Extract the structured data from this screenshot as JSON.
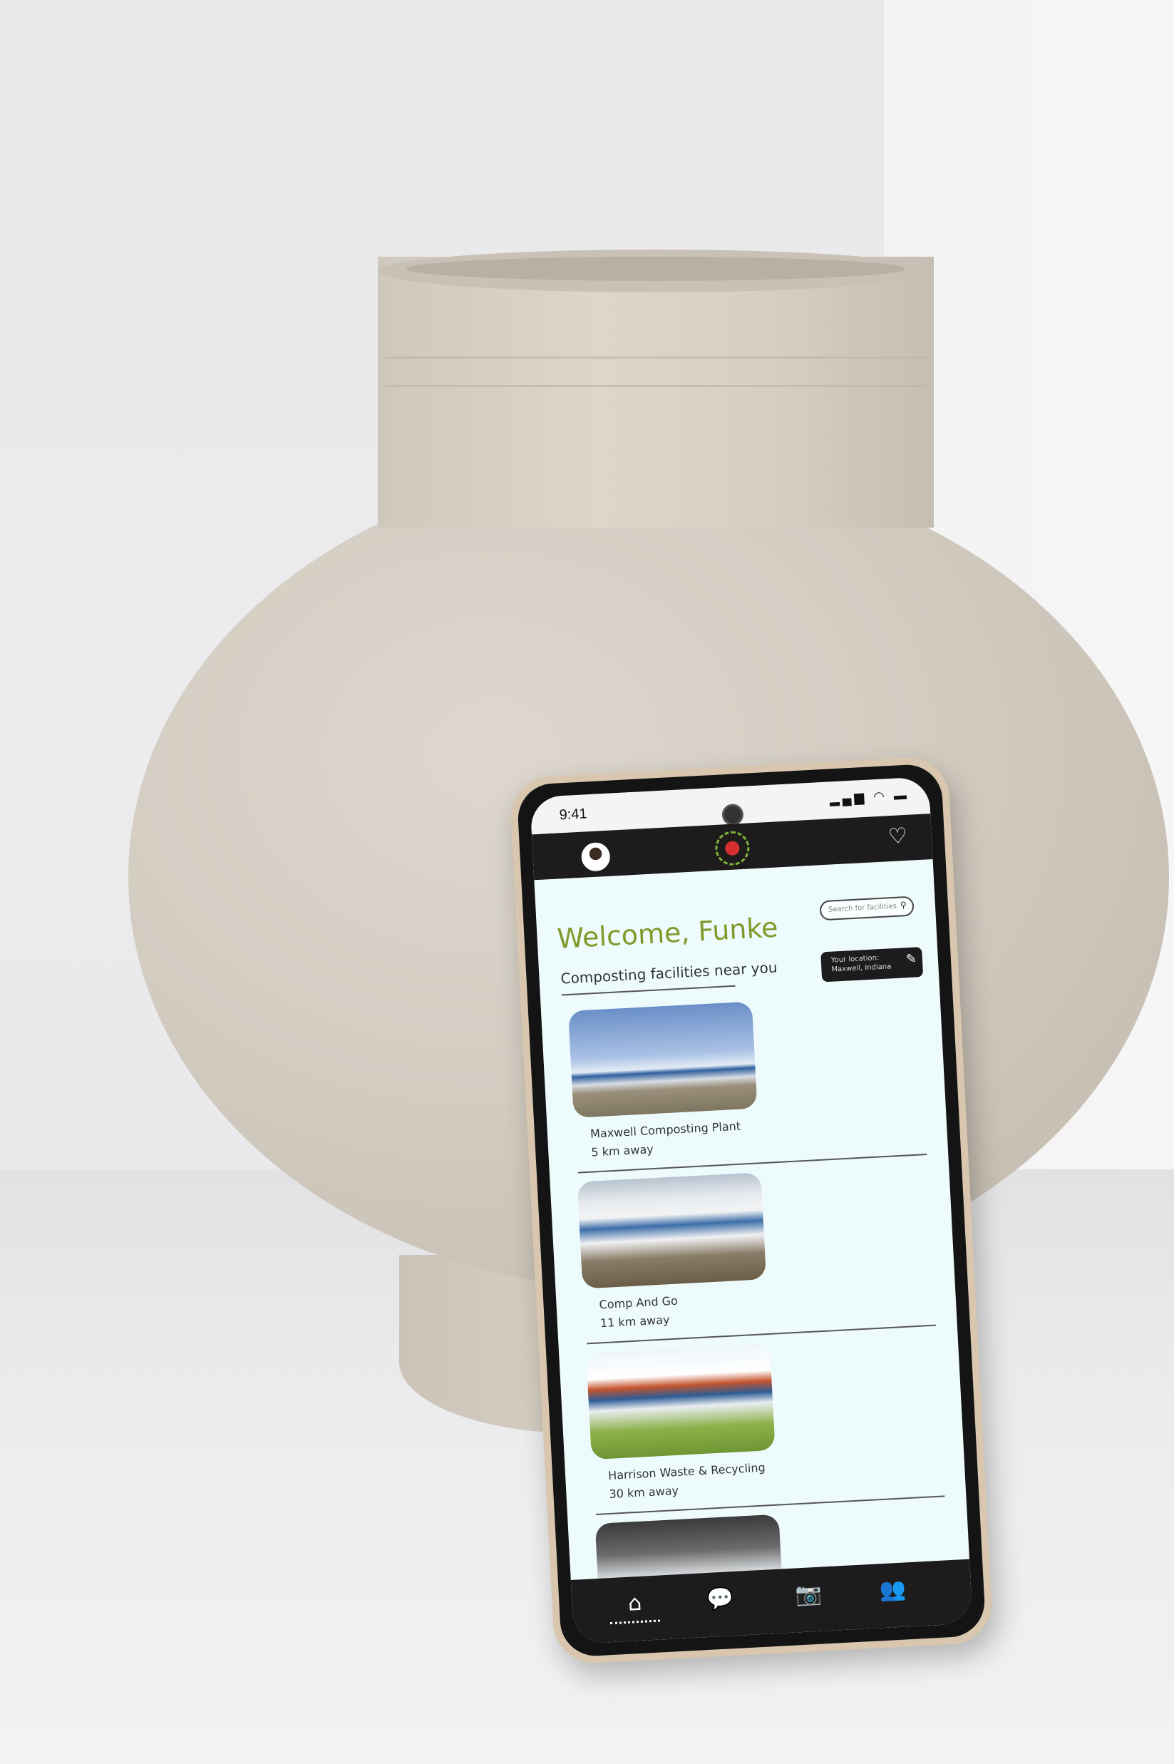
{
  "status_bar": {
    "time": "9:41",
    "icons": "▂▄▆ ◠ ▬"
  },
  "app_bar": {
    "avatar": "user-avatar",
    "logo": "apple-compost-logo",
    "favorites": "heart-icon"
  },
  "welcome": {
    "title": "Welcome, Funke"
  },
  "search": {
    "placeholder": "Search for facilities"
  },
  "location": {
    "label": "Your location:",
    "value": "Maxwell, Indiana"
  },
  "section": {
    "heading": "Composting facilities near you"
  },
  "facilities": [
    {
      "name": "Maxwell Composting Plant",
      "distance": "5 km away"
    },
    {
      "name": "Comp And Go",
      "distance": "11 km away"
    },
    {
      "name": "Harrison Waste & Recycling",
      "distance": "30 km away"
    },
    {
      "name": "",
      "distance": ""
    }
  ],
  "nav": {
    "items": [
      {
        "icon": "home-icon",
        "glyph": "⌂"
      },
      {
        "icon": "chat-icon",
        "glyph": "💬"
      },
      {
        "icon": "camera-icon",
        "glyph": "📷"
      },
      {
        "icon": "people-icon",
        "glyph": "👥"
      }
    ]
  },
  "colors": {
    "accent": "#7f9a2a",
    "dark": "#1d1b1b",
    "screen_bg": "#eefbfc"
  }
}
